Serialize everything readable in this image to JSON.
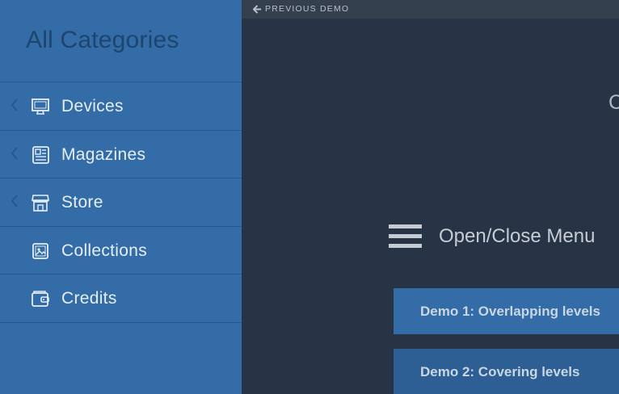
{
  "sidebar": {
    "title": "All Categories",
    "items": [
      {
        "label": "Devices",
        "icon": "monitor-icon",
        "has_submenu": true
      },
      {
        "label": "Magazines",
        "icon": "newspaper-icon",
        "has_submenu": true
      },
      {
        "label": "Store",
        "icon": "store-icon",
        "has_submenu": true
      },
      {
        "label": "Collections",
        "icon": "image-icon",
        "has_submenu": false
      },
      {
        "label": "Credits",
        "icon": "wallet-icon",
        "has_submenu": false
      }
    ]
  },
  "topbar": {
    "previous_demo": "PREVIOUS DEMO"
  },
  "main": {
    "cut_letter": "C",
    "toggle_label": "Open/Close Menu",
    "demo1_label": "Demo 1: Overlapping levels",
    "demo2_label": "Demo 2: Covering levels"
  },
  "colors": {
    "sidebar_bg": "#336ca6",
    "main_bg": "#263445",
    "topbar_bg": "#34404e"
  }
}
